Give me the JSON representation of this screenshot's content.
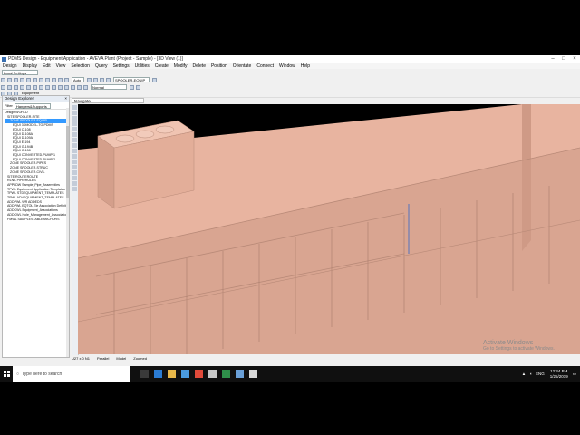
{
  "window": {
    "title": "PDMS Design - Equipment Application - AVEVA Plant (Project - Sample) - [3D View (1)]"
  },
  "menu": [
    "Design",
    "Display",
    "Edit",
    "View",
    "Selection",
    "Query",
    "Settings",
    "Utilities",
    "Create",
    "Modify",
    "Delete",
    "Position",
    "Orientate",
    "Connect",
    "Window",
    "Help"
  ],
  "toolbar": {
    "settings_dropdown": "Local Settings",
    "element_field": "SPOOLER-EQUIP",
    "mode_field": "Normal",
    "current_element": "Equipment",
    "auto_label": "Auto"
  },
  "explorer": {
    "title": "Design Explorer",
    "filter_label": "Filter",
    "filter_value": "Hangers&Supports",
    "items": [
      "Design WORLD",
      "SITE SPOOLER-SITE",
      "ZONE SPOOLER-EQUIP",
      "EQUI 3DMODEL-TO-PDMS",
      "EQUI C-108",
      "EQUI D-108A",
      "EQUI D-109A",
      "EQUI E-194",
      "EQUI G-194B",
      "EQUI C-108",
      "EQUI CONVERTED-PUMP-1",
      "EQUI CONVERTED-PUMP-2",
      "ZONE SPOOLER-PIPES",
      "ZONE SPOOLER-STRUC",
      "ZONE SPOOLER-CIVIL",
      "SITE ROUTEROUTE",
      "RLNK PIPE/RULES",
      "APPLDW Sample_Pipe_Assemblies",
      "TPWL Equipment Application Templates",
      "TPWL STDEQUIPMENT_TEMPLATES",
      "TPWL ADVEQUIPMENT_TEMPLATES",
      "ADDPWL WR ADDEDS",
      "ADDPWL EQTOL Ele Association Definitio",
      "ADDCWL Equipment_Associations",
      "ADDCWL Hole_Management_Associatio",
      "FMWL SAMPLESTABLEANCHORS"
    ],
    "selected_index": 2
  },
  "view": {
    "tab_label": "Navigate"
  },
  "status": {
    "coords": "U27 x 0 N1",
    "items": [
      "Parallel",
      "Model",
      "Zoomed"
    ]
  },
  "os_watermark": {
    "line1": "Activate Windows",
    "line2": "Go to Settings to activate Windows."
  },
  "taskbar": {
    "search_placeholder": "Type here to search",
    "tray_lang": "ENG",
    "time": "12:44 PM",
    "date": "1/25/2019"
  },
  "colors": {
    "model_fill": "#e8b4a0",
    "viewport_bg": "#000000",
    "selection": "#3399ff"
  }
}
